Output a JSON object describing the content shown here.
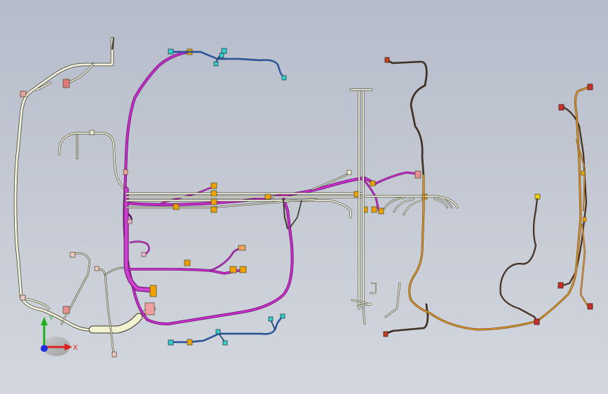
{
  "viewport": {
    "background_top": "#b6bccb",
    "background_bottom": "#d3d7df"
  },
  "triad": {
    "x_label": "X",
    "y_label": "Y",
    "x_color": "#e02020",
    "y_color": "#20b020",
    "z_color": "#2030e0"
  },
  "harness_colors": {
    "main_trunk": "#f2f2dc",
    "magenta": "#cc2ccc",
    "blue": "#2a62b8",
    "orange": "#d9952a",
    "brown": "#4a3a2a",
    "connector_orange": "#f0a000",
    "connector_pink": "#e89090",
    "connector_cyan": "#30d0d0",
    "connector_red": "#c83030"
  }
}
